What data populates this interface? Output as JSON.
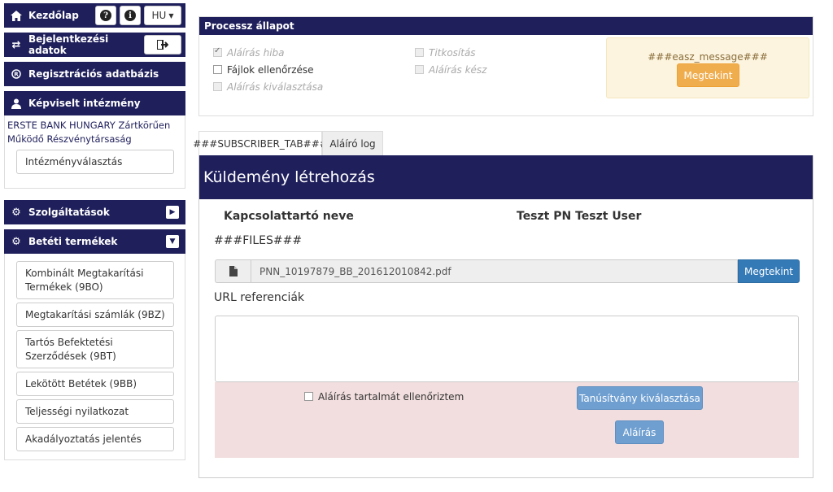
{
  "nav": {
    "home_label": "Kezdőlap",
    "lang": "HU",
    "login_label": "Bejelentkezési adatok",
    "registry_label": "Regisztrációs adatbázis",
    "represented_label": "Képviselt intézmény",
    "institution_name": "ERSTE BANK HUNGARY Zártkörűen Működő Részvénytársaság",
    "institution_select_label": "Intézményválasztás",
    "services_label": "Szolgáltatások",
    "deposit_label": "Betéti termékek",
    "products": [
      "Kombinált Megtakarítási Termékek (9BO)",
      "Megtakarítási számlák (9BZ)",
      "Tartós Befektetési Szerződések (9BT)",
      "Lekötött Betétek (9BB)",
      "Teljességi nyilatkozat",
      "Akadályoztatás jelentés"
    ]
  },
  "process": {
    "title": "Processz állapot",
    "checks": [
      {
        "label": "Aláírás hiba",
        "checked": true,
        "disabled": true
      },
      {
        "label": "Fájlok ellenőrzése",
        "checked": false,
        "disabled": false
      },
      {
        "label": "Aláírás kiválasztása",
        "checked": false,
        "disabled": true
      },
      {
        "label": "Titkosítás",
        "checked": false,
        "disabled": true
      },
      {
        "label": "Aláírás kész",
        "checked": false,
        "disabled": true
      }
    ],
    "message": "###easz_message###",
    "view_button": "Megtekint"
  },
  "tabs": [
    {
      "label": "###SUBSCRIBER_TAB###",
      "active": true
    },
    {
      "label": "Aláíró log",
      "active": false
    }
  ],
  "main": {
    "heading": "Küldemény létrehozás",
    "contact_label": "Kapcsolattartó neve",
    "contact_value": "Teszt PN Teszt User",
    "files_label": "###FILES###",
    "file_name": "PNN_10197879_BB_201612010842.pdf",
    "file_view_button": "Megtekint",
    "url_label": "URL referenciák",
    "url_value": "",
    "confirm_label": "Aláírás tartalmát ellenőriztem",
    "cert_button": "Tanúsítvány kiválasztása",
    "sign_button": "Aláírás"
  },
  "colors": {
    "navy": "#1f1f5c",
    "orange": "#f0ad4e",
    "blue": "#337ab7",
    "pink_bg": "#f2dede",
    "yellow_bg": "#fcf4de"
  },
  "icons": [
    "home-icon",
    "question-icon",
    "info-icon",
    "exchange-icon",
    "logout-icon",
    "registered-icon",
    "user-icon",
    "gear-icon",
    "toggle-right-icon",
    "toggle-down-icon",
    "file-icon"
  ]
}
